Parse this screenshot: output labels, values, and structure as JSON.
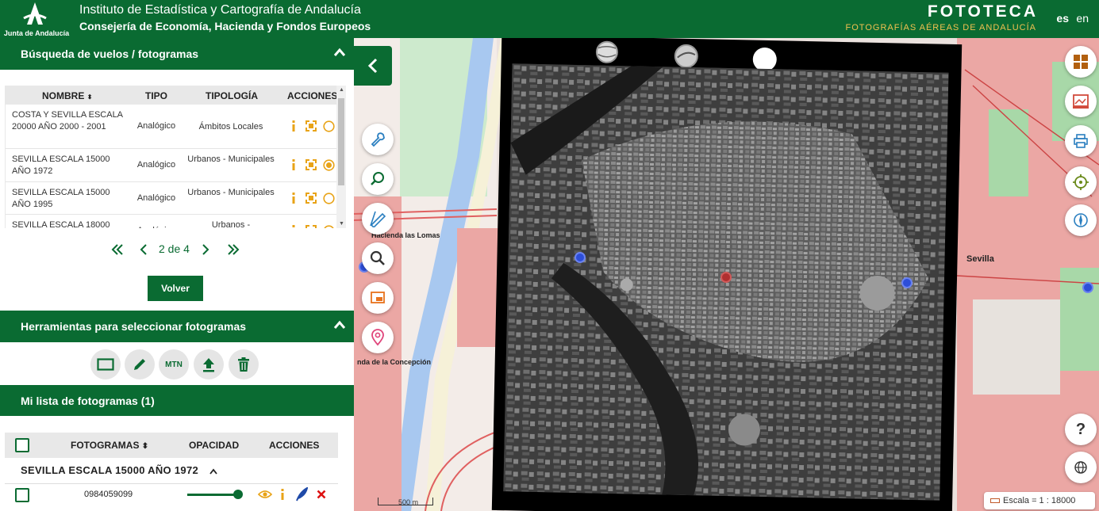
{
  "header": {
    "logo_text": "Junta de Andalucía",
    "institute": "Instituto de Estadística y Cartografía de Andalucía",
    "ministry": "Consejería de Economía, Hacienda y Fondos Europeos",
    "app_title": "FOTOTECA",
    "app_subtitle": "FOTOGRAFÍAS AÉREAS DE ANDALUCÍA",
    "lang_es": "es",
    "lang_en": "en"
  },
  "search_section": {
    "title": "Búsqueda de vuelos / fotogramas",
    "columns": {
      "name": "NOMBRE",
      "sort": "⬍",
      "type": "TIPO",
      "typology": "TIPOLOGÍA",
      "actions": "ACCIONES"
    },
    "rows": [
      {
        "name": "COSTA Y SEVILLA ESCALA 20000 AÑO 2000 - 2001",
        "type": "Analógico",
        "typology": "Ámbitos Locales",
        "selected": false
      },
      {
        "name": "SEVILLA ESCALA 15000 AÑO 1972",
        "type": "Analógico",
        "typology": "Urbanos - Municipales",
        "selected": true
      },
      {
        "name": "SEVILLA ESCALA 15000 AÑO 1995",
        "type": "Analógico",
        "typology": "Urbanos - Municipales",
        "selected": false
      },
      {
        "name": "SEVILLA ESCALA 18000",
        "type": "Analógico",
        "typology": "Urbanos -",
        "selected": false
      }
    ],
    "pagination": "2 de 4",
    "back_button": "Volver"
  },
  "tools_section": {
    "title": "Herramientas para seleccionar fotogramas",
    "mtn_label": "MTN"
  },
  "my_list": {
    "title": "Mi lista de fotogramas (1)",
    "columns": {
      "frames": "FOTOGRAMAS",
      "opacity": "OPACIDAD",
      "actions": "ACCIONES"
    },
    "group_title": "SEVILLA ESCALA 15000 AÑO 1972",
    "frame_code": "0984059099",
    "opacity": 1.0
  },
  "map": {
    "label_hacienda": "Hacienda las Lomas",
    "label_concepcion": "nda de la Concepción",
    "label_sevilla": "Sevilla",
    "scalebar_text": "500 m",
    "scale_text": "Escala = 1 : 18000"
  },
  "colors": {
    "brand_green": "#0a6b32",
    "accent_orange": "#e8a317",
    "map_pink": "#eba7a4",
    "map_green": "#a8d8a8",
    "water_blue": "#a8c8f0"
  }
}
